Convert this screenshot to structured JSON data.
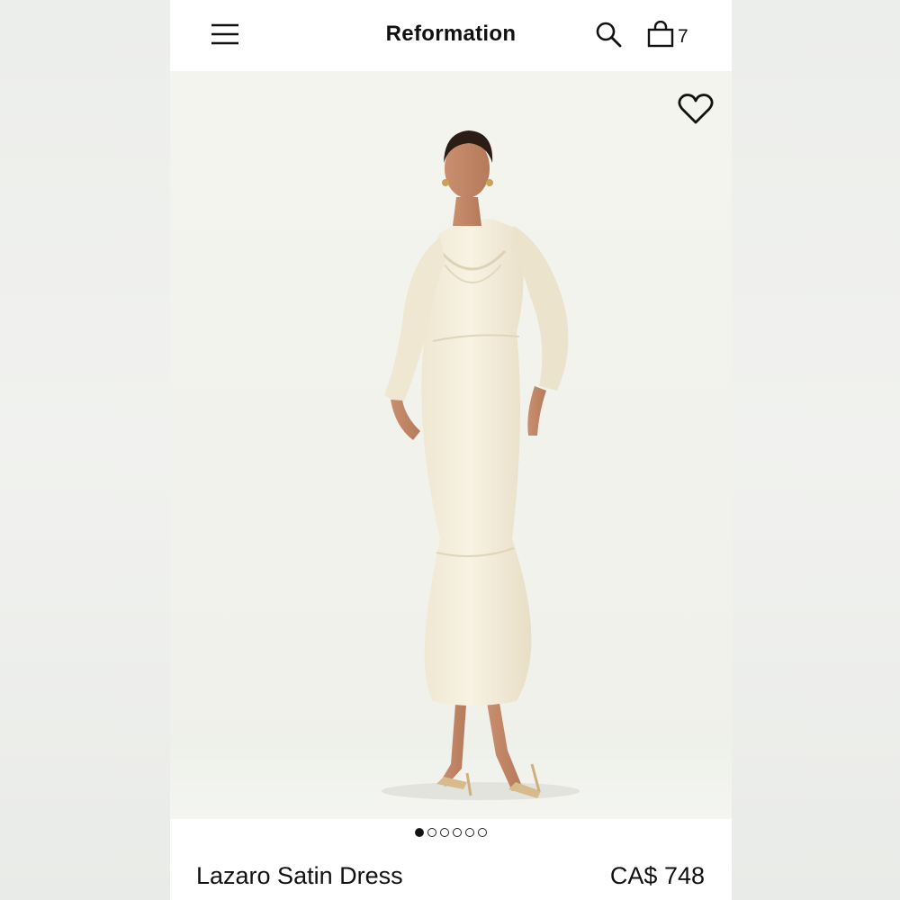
{
  "header": {
    "brand": "Reformation",
    "cart_count": "7",
    "icons": {
      "menu": "hamburger-menu-icon",
      "search": "search-icon",
      "bag": "shopping-bag-icon"
    }
  },
  "gallery": {
    "wishlist_icon": "heart-outline-icon",
    "image_subject": "model wearing long-sleeve cream satin midi dress with flounce hem and gold strappy heels",
    "dots_total": 6,
    "active_index": 0
  },
  "product": {
    "name": "Lazaro Satin Dress",
    "price": "CA$ 748"
  },
  "colors": {
    "dress": "#f3ecd9",
    "background": "#f3f3ed",
    "text": "#111111"
  }
}
